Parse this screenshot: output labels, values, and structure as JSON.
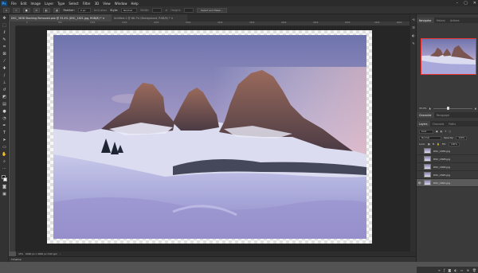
{
  "menubar": {
    "logo": "Ps",
    "items": [
      "File",
      "Edit",
      "Image",
      "Layer",
      "Type",
      "Select",
      "Filter",
      "3D",
      "View",
      "Window",
      "Help"
    ],
    "window_controls": [
      "–",
      "▢",
      "✕"
    ]
  },
  "options": {
    "feather_label": "Feather:",
    "feather_value": "0 px",
    "antialias_label": "Anti-alias",
    "style_label": "Style:",
    "style_value": "Normal",
    "width_label": "Width:",
    "height_label": "Height:",
    "select_mask_label": "Select and Mask..."
  },
  "tabs": [
    {
      "label": "DSC_3638 Stacking Removed.psb @ 33.4% (DSC_1821.jpg, RGB/8) * ✕",
      "active": true
    },
    {
      "label": "Untitled-1 @ 66.7% (Background, RGB/8) * ✕",
      "active": false
    }
  ],
  "ruler_h_ticks": [
    "0",
    "500",
    "1000",
    "1500",
    "2000",
    "2500",
    "3000",
    "3500",
    "4000",
    "4500",
    "5000",
    "5500",
    "6000"
  ],
  "status": {
    "zoom": "33%",
    "doc_info": "6000 px x 4000 px (240 ppi)",
    "arrow": "›"
  },
  "timeline_label": "Timeline",
  "navigator": {
    "tabs": [
      "Navigator",
      "History",
      "Actions"
    ],
    "zoom_value": "33.4%"
  },
  "mid_tabs": [
    "Character",
    "Paragraph"
  ],
  "layers": {
    "tabs": [
      "Layers",
      "Channels",
      "Paths"
    ],
    "kind_label": "Kind",
    "blend_mode": "Normal",
    "opacity_label": "Opacity:",
    "opacity_value": "100%",
    "lock_label": "Lock:",
    "fill_label": "Fill:",
    "fill_value": "100%",
    "rows": [
      {
        "name": "DSC_1835.jpg",
        "selected": false
      },
      {
        "name": "DSC_1828.jpg",
        "selected": false
      },
      {
        "name": "DSC_1826.jpg",
        "selected": false
      },
      {
        "name": "DSC_1825.jpg",
        "selected": false
      },
      {
        "name": "DSC_1821.jpg",
        "selected": true
      }
    ],
    "footer_icons": [
      "link-icon",
      "fx-icon",
      "mask-icon",
      "adjustment-icon",
      "group-icon",
      "new-layer-icon",
      "trash-icon"
    ]
  },
  "colors": {
    "accent": "#31a8ff",
    "panel": "#3a3a3a",
    "canvas_bg": "#262626",
    "selected_layer": "#5a5a5a"
  }
}
